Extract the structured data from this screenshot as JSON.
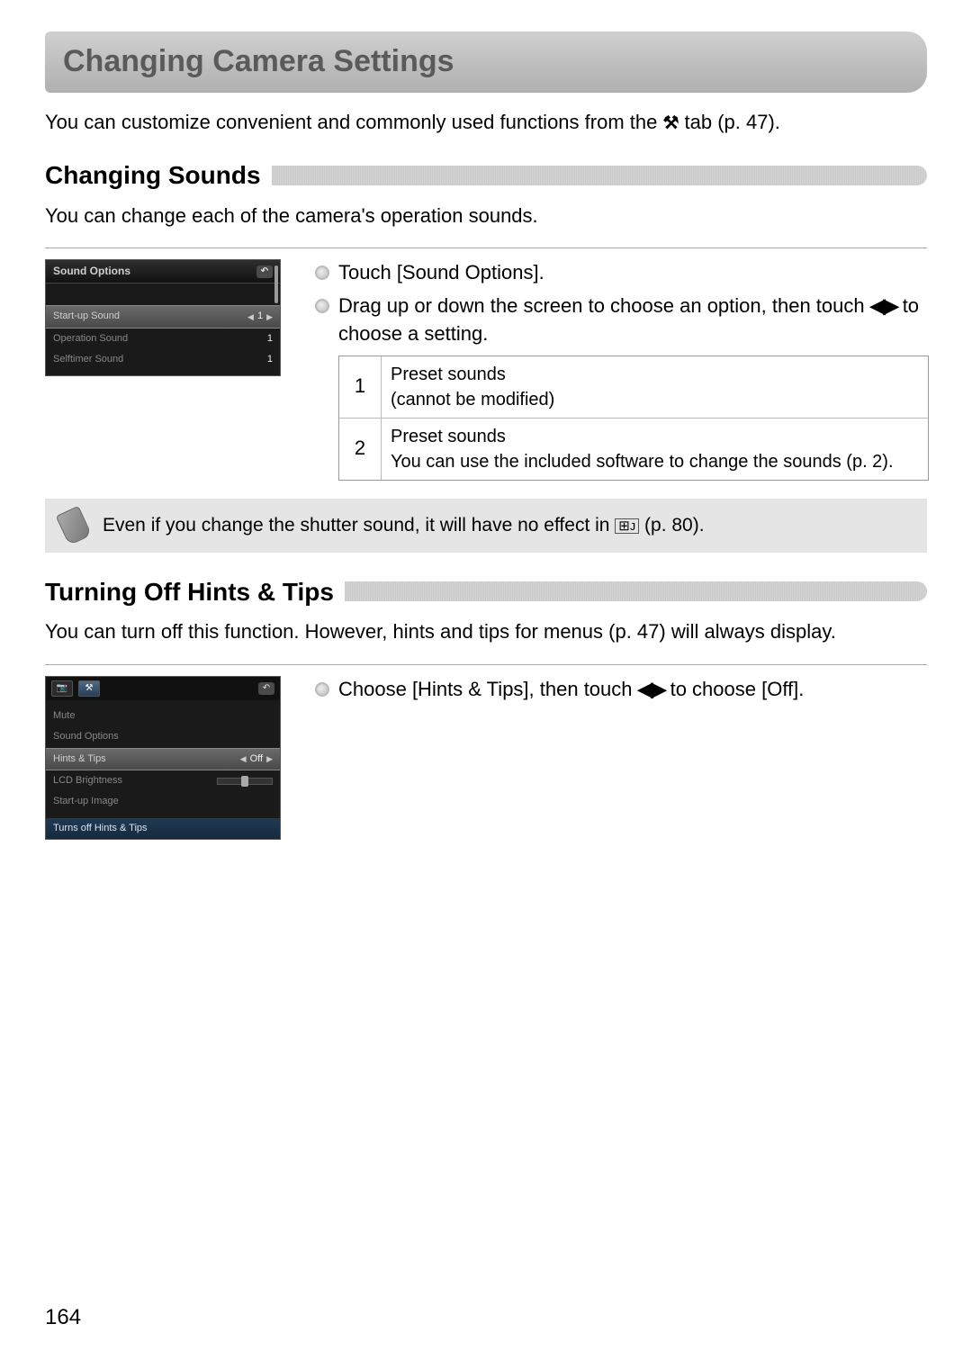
{
  "title": "Changing Camera Settings",
  "intro_prefix": "You can customize convenient and commonly used functions from the ",
  "intro_tab_icon": "⚒",
  "intro_suffix": " tab (p. 47).",
  "section1": {
    "title": "Changing Sounds",
    "desc": "You can change each of the camera's operation sounds.",
    "screenshot": {
      "title": "Sound Options",
      "row1_label": "Start-up Sound",
      "row1_value": "1",
      "row2_label": "Operation Sound",
      "row2_value": "1",
      "row3_label": "Selftimer Sound",
      "row3_value": "1"
    },
    "instr1": "Touch [Sound Options].",
    "instr2_pre": "Drag up or down the screen to choose an option, then touch ",
    "instr2_post": " to choose a setting.",
    "table": {
      "r1_num": "1",
      "r1_desc": "Preset sounds\n(cannot be modified)",
      "r2_num": "2",
      "r2_desc": "Preset sounds\nYou can use the included software to change the sounds (p. 2)."
    },
    "note_pre": "Even if you change the shutter sound, it will have no effect in ",
    "note_icon": "⊞ᴊ",
    "note_post": " (p. 80)."
  },
  "section2": {
    "title": "Turning Off Hints & Tips",
    "desc": "You can turn off this function. However, hints and tips for menus (p. 47) will always display.",
    "screenshot": {
      "tab1": "📷",
      "tab2": "⚒",
      "row0_label": "Mute",
      "row1_label": "Sound Options",
      "row2_label": "Hints & Tips",
      "row2_value": "Off",
      "row3_label": "LCD Brightness",
      "row4_label": "Start-up Image",
      "hint": "Turns off Hints & Tips"
    },
    "instr1_pre": "Choose [Hints & Tips], then touch ",
    "instr1_post": " to choose [Off]."
  },
  "page_number": "164"
}
